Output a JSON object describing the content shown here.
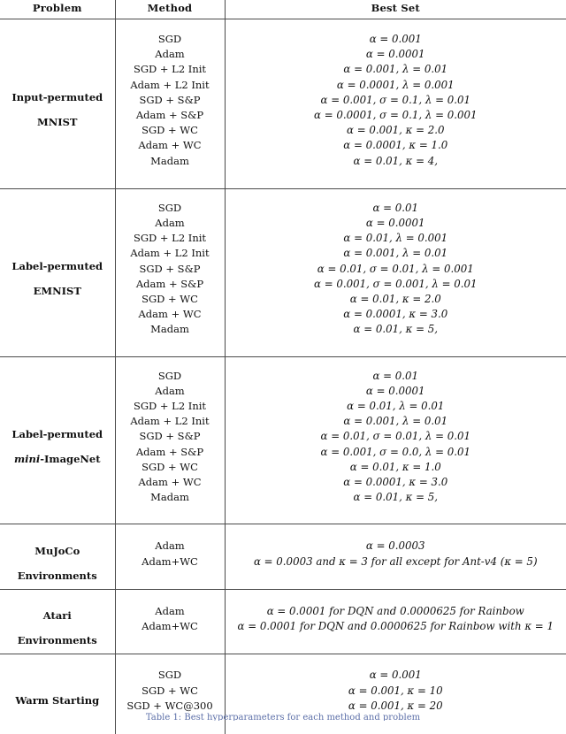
{
  "table": {
    "headers": {
      "problem": "Problem",
      "method": "Method",
      "best_set": "Best Set"
    },
    "rows": [
      {
        "problem_line1": "Input-permuted",
        "problem_line2": "MNIST",
        "problem_italic": "",
        "methods": [
          "SGD",
          "Adam",
          "SGD + L2 Init",
          "Adam + L2 Init",
          "SGD + S&P",
          "Adam + S&P",
          "SGD + WC",
          "Adam + WC",
          "Madam"
        ],
        "best_sets": [
          "α = 0.001",
          "α = 0.0001",
          "α = 0.001, λ = 0.01",
          "α = 0.0001, λ = 0.001",
          "α = 0.001, σ = 0.1, λ = 0.01",
          "α = 0.0001, σ = 0.1, λ = 0.001",
          "α = 0.001, κ = 2.0",
          "α = 0.0001, κ = 1.0",
          "α = 0.01, κ = 4,"
        ]
      },
      {
        "problem_line1": "Label-permuted",
        "problem_line2": "EMNIST",
        "problem_italic": "",
        "methods": [
          "SGD",
          "Adam",
          "SGD + L2 Init",
          "Adam + L2 Init",
          "SGD + S&P",
          "Adam + S&P",
          "SGD + WC",
          "Adam + WC",
          "Madam"
        ],
        "best_sets": [
          "α = 0.01",
          "α = 0.0001",
          "α = 0.01, λ = 0.001",
          "α = 0.001, λ = 0.01",
          "α = 0.01, σ = 0.01, λ = 0.001",
          "α = 0.001, σ = 0.001, λ = 0.01",
          "α = 0.01, κ = 2.0",
          "α = 0.0001, κ = 3.0",
          "α = 0.01, κ = 5,"
        ]
      },
      {
        "problem_line1": "Label-permuted",
        "problem_line2": "-ImageNet",
        "problem_italic": "mini",
        "methods": [
          "SGD",
          "Adam",
          "SGD + L2 Init",
          "Adam + L2 Init",
          "SGD + S&P",
          "Adam + S&P",
          "SGD + WC",
          "Adam + WC",
          "Madam"
        ],
        "best_sets": [
          "α = 0.01",
          "α = 0.0001",
          "α = 0.01, λ = 0.01",
          "α = 0.001, λ = 0.01",
          "α = 0.01, σ = 0.01, λ = 0.01",
          "α = 0.001, σ = 0.0, λ = 0.01",
          "α = 0.01, κ = 1.0",
          "α = 0.0001, κ = 3.0",
          "α = 0.01, κ = 5,"
        ]
      },
      {
        "problem_line1": "MuJoCo",
        "problem_line2": "Environments",
        "problem_italic": "",
        "methods": [
          "Adam",
          "Adam+WC"
        ],
        "best_sets": [
          "α = 0.0003",
          "α = 0.0003 and κ = 3 for all except for Ant-v4 (κ = 5)"
        ]
      },
      {
        "problem_line1": "Atari",
        "problem_line2": "Environments",
        "problem_italic": "",
        "methods": [
          "Adam",
          "Adam+WC"
        ],
        "best_sets": [
          "α = 0.0001 for DQN and 0.0000625 for Rainbow",
          "α = 0.0001 for DQN and 0.0000625 for Rainbow with κ = 1"
        ]
      },
      {
        "problem_line1": "Warm Starting",
        "problem_line2": "",
        "problem_italic": "",
        "methods": [
          "SGD",
          "SGD + WC",
          "SGD + WC@300"
        ],
        "best_sets": [
          "α = 0.001",
          "α = 0.001, κ = 10",
          "α = 0.001, κ = 20"
        ]
      }
    ]
  },
  "caption": {
    "text": "Table 1: Best hyperparameters for each method and problem"
  },
  "colors": {
    "rule": "#4a4a4a",
    "text": "#111111",
    "caption": "#5c6fa8",
    "background": "#ffffff"
  }
}
